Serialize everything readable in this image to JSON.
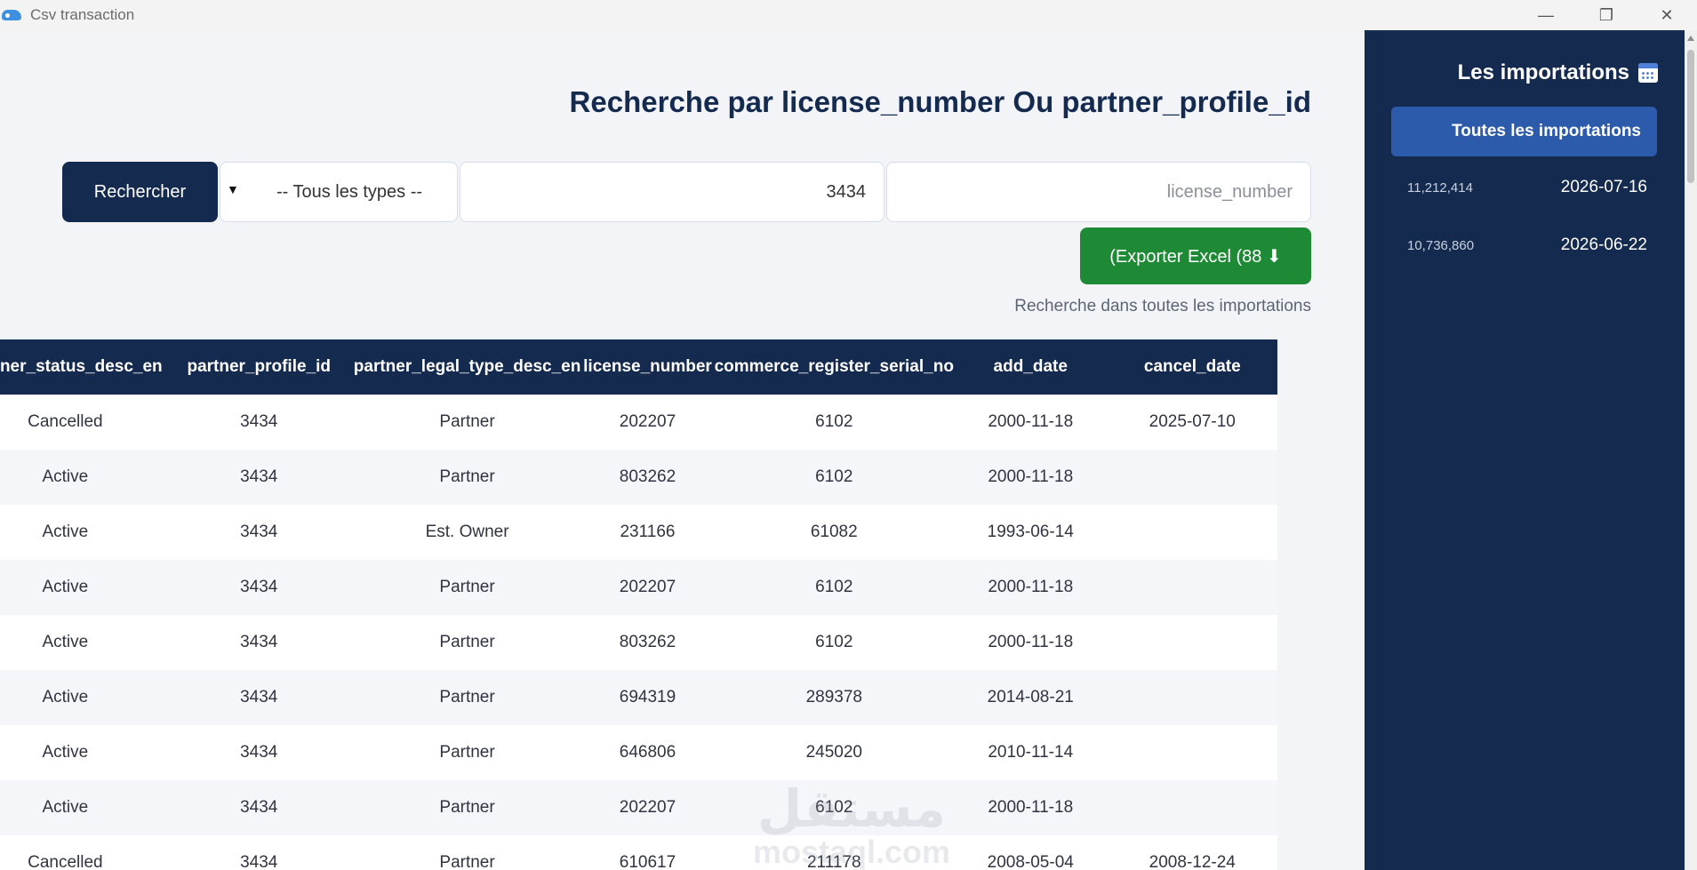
{
  "window": {
    "title": "Csv transaction",
    "minimize_icon": "—",
    "restore_icon": "❐",
    "close_icon": "✕"
  },
  "main": {
    "heading": "Recherche par license_number Ou partner_profile_id",
    "search_button": "Rechercher",
    "type_select": {
      "caret": "▼",
      "selected": "-- Tous les types --"
    },
    "partner_input_value": "3434",
    "license_placeholder": "license_number",
    "export_button": "(Exporter Excel (88 ⬇",
    "search_note": "Recherche dans toutes les importations"
  },
  "table": {
    "columns": [
      "partner_status_desc_en",
      "partner_profile_id",
      "partner_legal_type_desc_en",
      "license_number",
      "commerce_register_serial_no",
      "add_date",
      "cancel_date"
    ],
    "rows": [
      [
        "Cancelled",
        "3434",
        "Partner",
        "202207",
        "6102",
        "2000-11-18",
        "2025-07-10"
      ],
      [
        "Active",
        "3434",
        "Partner",
        "803262",
        "6102",
        "2000-11-18",
        ""
      ],
      [
        "Active",
        "3434",
        "Est. Owner",
        "231166",
        "61082",
        "1993-06-14",
        ""
      ],
      [
        "Active",
        "3434",
        "Partner",
        "202207",
        "6102",
        "2000-11-18",
        ""
      ],
      [
        "Active",
        "3434",
        "Partner",
        "803262",
        "6102",
        "2000-11-18",
        ""
      ],
      [
        "Active",
        "3434",
        "Partner",
        "694319",
        "289378",
        "2014-08-21",
        ""
      ],
      [
        "Active",
        "3434",
        "Partner",
        "646806",
        "245020",
        "2010-11-14",
        ""
      ],
      [
        "Active",
        "3434",
        "Partner",
        "202207",
        "6102",
        "2000-11-18",
        ""
      ],
      [
        "Cancelled",
        "3434",
        "Partner",
        "610617",
        "211178",
        "2008-05-04",
        "2008-12-24"
      ]
    ]
  },
  "watermark": {
    "arabic": "مستقل",
    "latin": "mostaql.com"
  },
  "sidebar": {
    "title": "Les importations",
    "all_button": "Toutes les importations",
    "imports": [
      {
        "count": "11,212,414",
        "date": "2026-07-16"
      },
      {
        "count": "10,736,860",
        "date": "2026-06-22"
      }
    ]
  }
}
